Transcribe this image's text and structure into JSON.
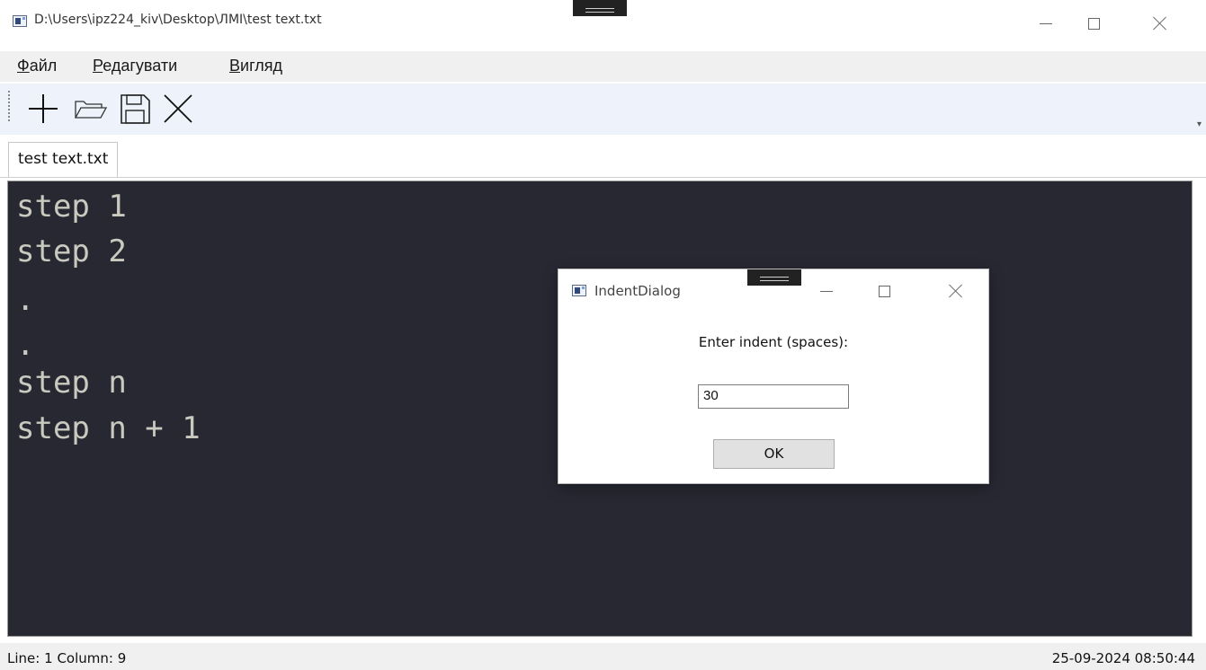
{
  "window": {
    "title": "D:\\Users\\ipz224_kiv\\Desktop\\ЛМІ\\test text.txt"
  },
  "menu": {
    "file": {
      "accel": "Ф",
      "rest": "айл"
    },
    "edit": {
      "accel": "Р",
      "rest": "едагувати"
    },
    "view": {
      "accel": "В",
      "rest": "игляд"
    }
  },
  "toolbar": {
    "icons": [
      "new-icon",
      "open-folder-icon",
      "save-icon",
      "close-file-icon"
    ],
    "overflow": "▾"
  },
  "tabs": [
    {
      "label": "test text.txt",
      "active": true
    }
  ],
  "editor": {
    "background": "#272832",
    "text_color": "#c9c9bf",
    "lines": [
      "step 1",
      "step 2",
      ".",
      ".",
      "step n",
      "step n + 1"
    ]
  },
  "status": {
    "line_label": "Line:",
    "line_value": "1",
    "column_label": "Column:",
    "column_value": "9",
    "datetime": "25-09-2024 08:50:44"
  },
  "dialog": {
    "title": "IndentDialog",
    "prompt": "Enter indent (spaces):",
    "input_value": "30",
    "ok_label": "OK"
  }
}
